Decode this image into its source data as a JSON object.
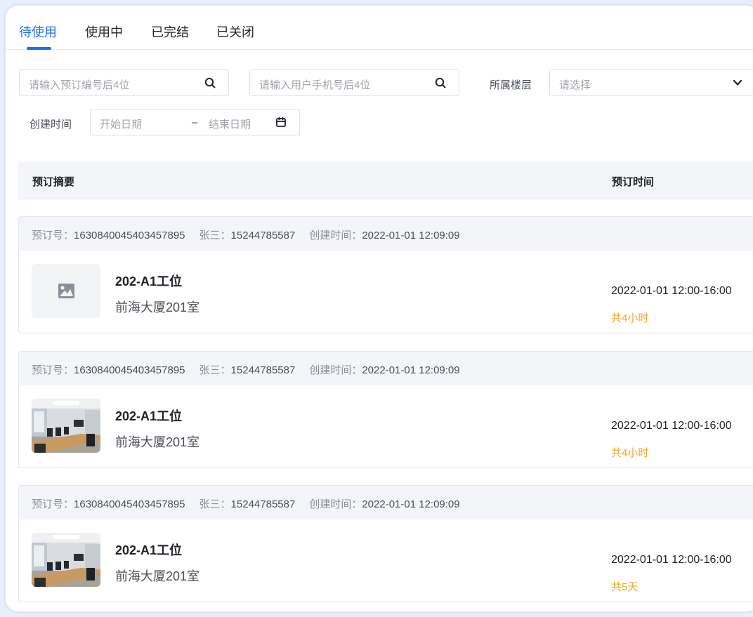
{
  "tabs": [
    {
      "label": "待使用",
      "active": true
    },
    {
      "label": "使用中",
      "active": false
    },
    {
      "label": "已完结",
      "active": false
    },
    {
      "label": "已关闭",
      "active": false
    }
  ],
  "filters": {
    "order_no_placeholder": "请输入预订编号后4位",
    "phone_placeholder": "请输入用户手机号后4位",
    "floor_label": "所属楼层",
    "floor_placeholder": "请选择",
    "created_label": "创建时间",
    "start_placeholder": "开始日期",
    "range_sep": "–",
    "end_placeholder": "结束日期"
  },
  "table": {
    "col_summary": "预订摘要",
    "col_time": "预订时间"
  },
  "orders": [
    {
      "order_label": "预订号：",
      "order_no": "1630840045403457895",
      "user_label": "张三：",
      "phone": "15244785587",
      "created_label": "创建时间：",
      "created": "2022-01-01 12:09:09",
      "title": "202-A1工位",
      "location": "前海大厦201室",
      "time": "2022-01-01  12:00-16:00",
      "duration": "共4小时",
      "thumb": "placeholder-image-icon"
    },
    {
      "order_label": "预订号：",
      "order_no": "1630840045403457895",
      "user_label": "张三：",
      "phone": "15244785587",
      "created_label": "创建时间：",
      "created": "2022-01-01 12:09:09",
      "title": "202-A1工位",
      "location": "前海大厦201室",
      "time": "2022-01-01  12:00-16:00",
      "duration": "共4小时",
      "thumb": "meeting-room-photo"
    },
    {
      "order_label": "预订号：",
      "order_no": "1630840045403457895",
      "user_label": "张三：",
      "phone": "15244785587",
      "created_label": "创建时间：",
      "created": "2022-01-01 12:09:09",
      "title": "202-A1工位",
      "location": "前海大厦201室",
      "time": "2022-01-01  12:00-16:00",
      "duration": "共5天",
      "thumb": "meeting-room-photo"
    }
  ],
  "colors": {
    "accent": "#1b6ff5",
    "duration": "#f5a623",
    "header_bg": "#f3f5f8"
  }
}
